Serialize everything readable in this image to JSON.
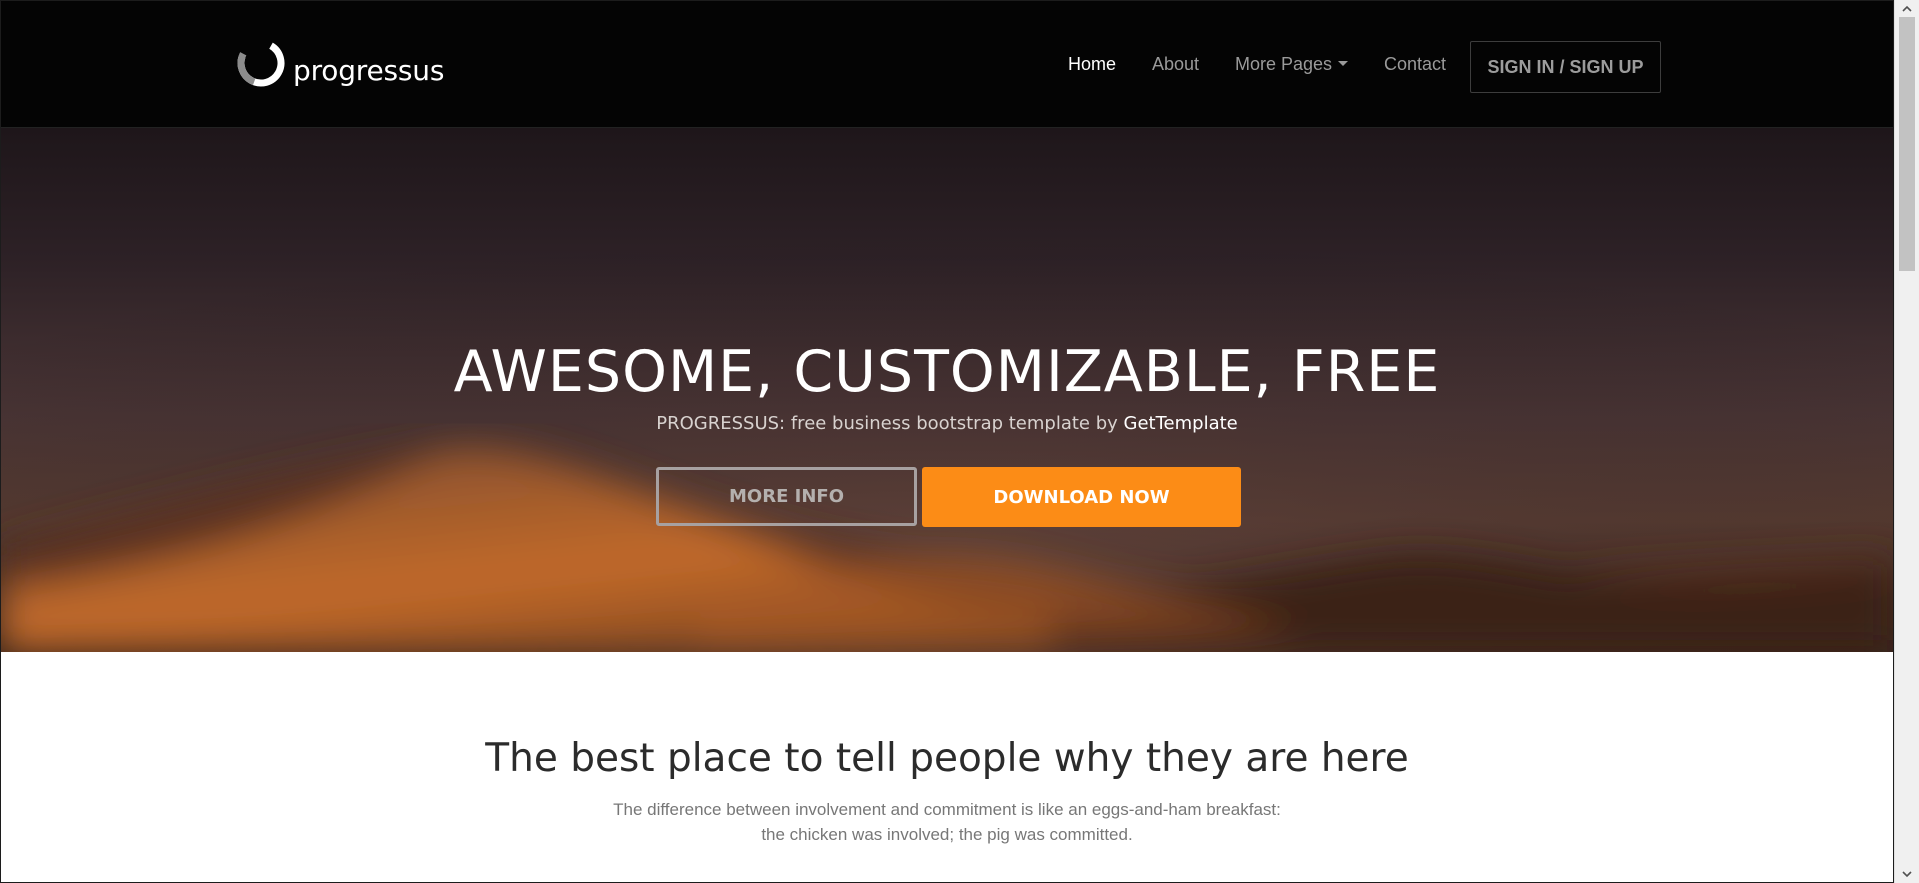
{
  "brand": {
    "name": "progressus",
    "logo_icon": "progressus-ring-logo"
  },
  "nav": {
    "items": [
      {
        "label": "Home",
        "active": true
      },
      {
        "label": "About",
        "active": false
      },
      {
        "label": "More Pages",
        "active": false,
        "has_dropdown": true
      },
      {
        "label": "Contact",
        "active": false
      }
    ],
    "signin_label": "SIGN IN / SIGN UP"
  },
  "hero": {
    "title": "AWESOME, CUSTOMIZABLE, FREE",
    "subtitle_prefix": "PROGRESSUS: free business bootstrap template by ",
    "subtitle_link": "GetTemplate",
    "more_info_label": "MORE INFO",
    "download_label": "DOWNLOAD NOW"
  },
  "intro": {
    "title": "The best place to tell people why they are here",
    "text_line1": "The difference between involvement and commitment is like an eggs-and-ham breakfast:",
    "text_line2": "the chicken was involved; the pig was committed."
  },
  "colors": {
    "navbar_bg": "#040404",
    "accent_orange": "#fc8c16",
    "nav_active": "#ffffff",
    "nav_inactive": "#9a9a9a"
  },
  "scrollbar": {
    "up_icon": "chevron-up-icon",
    "down_icon": "chevron-down-icon"
  }
}
